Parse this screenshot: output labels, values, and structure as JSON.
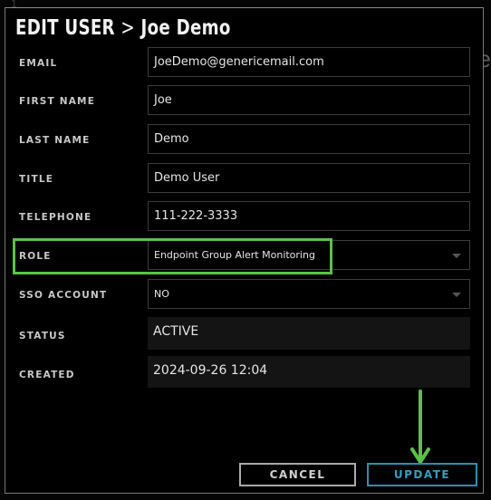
{
  "background": {
    "top_left_glyph": "1",
    "right_edge_glyph": "e"
  },
  "dialog": {
    "title_prefix": "EDIT USER",
    "title_separator": ">",
    "title_user": "Joe Demo"
  },
  "fields": [
    {
      "key": "email",
      "label": "EMAIL",
      "value": "JoeDemo@genericemail.com",
      "type": "text"
    },
    {
      "key": "first_name",
      "label": "FIRST NAME",
      "value": "Joe",
      "type": "text"
    },
    {
      "key": "last_name",
      "label": "LAST NAME",
      "value": "Demo",
      "type": "text"
    },
    {
      "key": "title",
      "label": "TITLE",
      "value": "Demo User",
      "type": "text"
    },
    {
      "key": "telephone",
      "label": "TELEPHONE",
      "value": "111-222-3333",
      "type": "text"
    },
    {
      "key": "role",
      "label": "ROLE",
      "value": "Endpoint Group Alert Monitoring",
      "type": "select"
    },
    {
      "key": "sso_account",
      "label": "SSO ACCOUNT",
      "value": "NO",
      "type": "select"
    },
    {
      "key": "status",
      "label": "STATUS",
      "value": "ACTIVE",
      "type": "readonly"
    },
    {
      "key": "created",
      "label": "CREATED",
      "value": "2024-09-26 12:04",
      "type": "readonly"
    }
  ],
  "buttons": {
    "cancel": "CANCEL",
    "update": "UPDATE"
  },
  "annotations": {
    "highlight_color": "#5cc14a",
    "highlight_target": "role",
    "arrow_color": "#5cc14a",
    "arrow_target": "update"
  },
  "colors": {
    "accent": "#2f8fae",
    "text": "#e6e6e6",
    "label": "#c8c8c8"
  }
}
